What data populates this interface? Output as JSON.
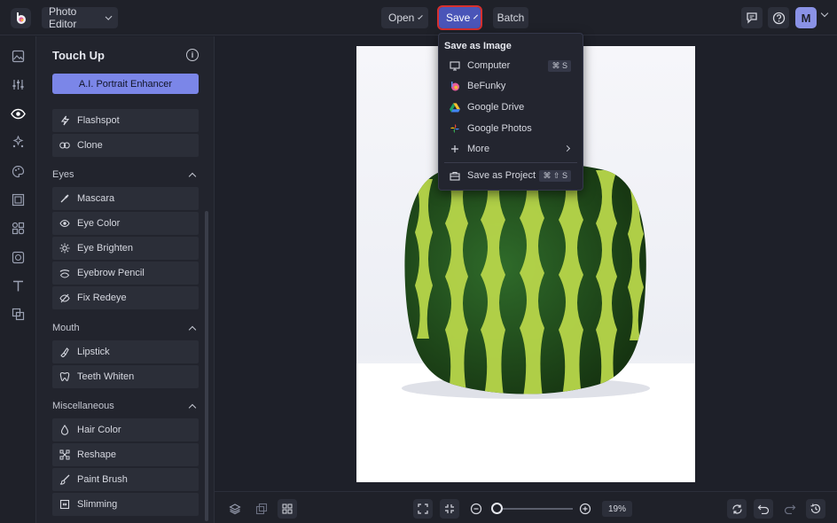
{
  "topbar": {
    "app_menu_label": "Photo Editor",
    "open_label": "Open",
    "save_label": "Save",
    "batch_label": "Batch",
    "avatar_letter": "M"
  },
  "panel": {
    "title": "Touch Up",
    "ai_button_label": "A.I. Portrait Enhancer",
    "tools_top": [
      {
        "label": "Flashspot",
        "icon": "lightning-icon"
      },
      {
        "label": "Clone",
        "icon": "clone-icon"
      }
    ],
    "sections": [
      {
        "title": "Eyes",
        "items": [
          {
            "label": "Mascara",
            "icon": "mascara-brush-icon"
          },
          {
            "label": "Eye Color",
            "icon": "eye-color-icon"
          },
          {
            "label": "Eye Brighten",
            "icon": "sun-icon"
          },
          {
            "label": "Eyebrow Pencil",
            "icon": "eyebrow-icon"
          },
          {
            "label": "Fix Redeye",
            "icon": "eye-slash-icon"
          }
        ]
      },
      {
        "title": "Mouth",
        "items": [
          {
            "label": "Lipstick",
            "icon": "lipstick-icon"
          },
          {
            "label": "Teeth Whiten",
            "icon": "tooth-icon"
          }
        ]
      },
      {
        "title": "Miscellaneous",
        "items": [
          {
            "label": "Hair Color",
            "icon": "drop-icon"
          },
          {
            "label": "Reshape",
            "icon": "reshape-icon"
          },
          {
            "label": "Paint Brush",
            "icon": "brush-icon"
          },
          {
            "label": "Slimming",
            "icon": "slimming-icon"
          }
        ]
      }
    ]
  },
  "save_menu": {
    "heading": "Save as Image",
    "items": [
      {
        "label": "Computer",
        "icon": "monitor-icon",
        "shortcut": "⌘ S"
      },
      {
        "label": "BeFunky",
        "icon": "befunky-icon",
        "shortcut": ""
      },
      {
        "label": "Google Drive",
        "icon": "google-drive-icon",
        "shortcut": ""
      },
      {
        "label": "Google Photos",
        "icon": "google-photos-icon",
        "shortcut": ""
      },
      {
        "label": "More",
        "icon": "plus-icon",
        "shortcut": ""
      }
    ],
    "project_item": {
      "label": "Save as Project",
      "icon": "briefcase-icon",
      "shortcut": "⌘ ⇧ S"
    }
  },
  "bottombar": {
    "zoom_value": "19%",
    "zoom_fraction": 0.05
  },
  "colors": {
    "accent": "#7b86e8",
    "save_button": "#4a55b8",
    "highlight_outline": "#d6302f",
    "background": "#1e2029"
  }
}
